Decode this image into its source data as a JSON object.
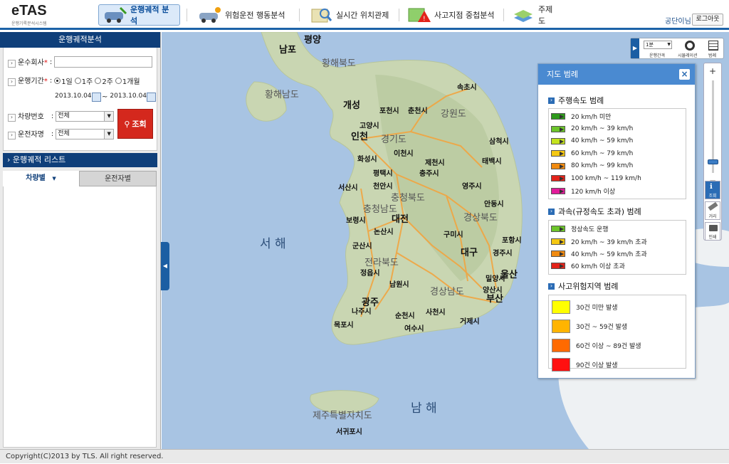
{
  "header": {
    "logo": "eTAS",
    "logo_sub": "운행기록분석시스템",
    "nav": [
      {
        "label": "운행궤적 분석",
        "active": true
      },
      {
        "label": "위험운전 행동분석",
        "active": false
      },
      {
        "label": "실시간 위치관제",
        "active": false
      },
      {
        "label": "사고지점 중첩분석",
        "active": false
      },
      {
        "label": "주제도",
        "active": false
      }
    ],
    "user": "공단이님",
    "logout": "로그아웃"
  },
  "left": {
    "title": "운행궤적분석",
    "company_label": "운수회사",
    "period_label": "운행기간",
    "periods": [
      "1일",
      "1주",
      "2주",
      "1개월"
    ],
    "selected_period": "1일",
    "date_from": "2013.10.04",
    "date_sep": "~",
    "date_to": "2013.10.04",
    "vehicle_label": "차량번호",
    "vehicle_value": "전체",
    "driver_label": "운전자명",
    "driver_value": "전체",
    "search_button": "조회",
    "list_title": "운행궤적 리스트",
    "tabs": [
      "차량별",
      "운전자별"
    ],
    "required_mark": "*",
    "colon": ":"
  },
  "map": {
    "labels": [
      "평양",
      "남포",
      "황해북도",
      "황해남도",
      "개성",
      "강원도",
      "속초시",
      "포천시",
      "춘천시",
      "고양시",
      "인천",
      "경기도",
      "삼척시",
      "화성시",
      "이천시",
      "제천시",
      "태백시",
      "평택시",
      "충주시",
      "서산시",
      "천안시",
      "충청북도",
      "영주시",
      "충청남도",
      "대전",
      "보령시",
      "안동시",
      "경상북도",
      "서 해",
      "논산시",
      "구미시",
      "포항시",
      "군산시",
      "대구",
      "경주시",
      "전라북도",
      "정읍시",
      "울산",
      "밀양시",
      "남원시",
      "경상남도",
      "광주",
      "양산시",
      "부산",
      "나주시",
      "순천시",
      "사천시",
      "거제시",
      "목포시",
      "여수시",
      "남 해",
      "제주특별자치도",
      "서귀포시"
    ]
  },
  "controls": {
    "time_select": "1분",
    "time_label": "운행간격",
    "sim_label": "시뮬레이션",
    "legend_label": "범례",
    "zoom_in": "+",
    "zoom_out": "−",
    "side": [
      "조회",
      "거리",
      "인쇄"
    ]
  },
  "legend": {
    "title": "지도 범례",
    "close": "×",
    "sec1": "주행속도 범례",
    "speed": [
      {
        "label": "20 km/h 미만",
        "color": "#2e9a1c"
      },
      {
        "label": "20 km/h ~ 39 km/h",
        "color": "#6cc52a"
      },
      {
        "label": "40 km/h ~ 59 km/h",
        "color": "#c4e31e"
      },
      {
        "label": "60 km/h ~ 79 km/h",
        "color": "#f5c812"
      },
      {
        "label": "80 km/h ~ 99 km/h",
        "color": "#f08a10"
      },
      {
        "label": "100 km/h ~ 119 km/h",
        "color": "#e2231a"
      },
      {
        "label": "120 km/h 이상",
        "color": "#e21a9a"
      }
    ],
    "sec2": "과속(규정속도 초과) 범례",
    "over": [
      {
        "label": "정상속도 운행",
        "color": "#6cc52a"
      },
      {
        "label": "20 km/h ~ 39 km/h 초과",
        "color": "#f5c812"
      },
      {
        "label": "40 km/h ~ 59 km/h 초과",
        "color": "#f08a10"
      },
      {
        "label": "60 km/h 이상 초과",
        "color": "#e2231a"
      }
    ],
    "sec3": "사고위험지역 범례",
    "risk": [
      {
        "label": "30건 미만 발생",
        "color": "#ffff00"
      },
      {
        "label": "30건 ~ 59건 발생",
        "color": "#ffb400"
      },
      {
        "label": "60건 이상 ~ 89건 발생",
        "color": "#ff6a00"
      },
      {
        "label": "90건 이상 발생",
        "color": "#ff1010"
      }
    ]
  },
  "footer": "Copyright(C)2013 by TLS.  All right reserved."
}
